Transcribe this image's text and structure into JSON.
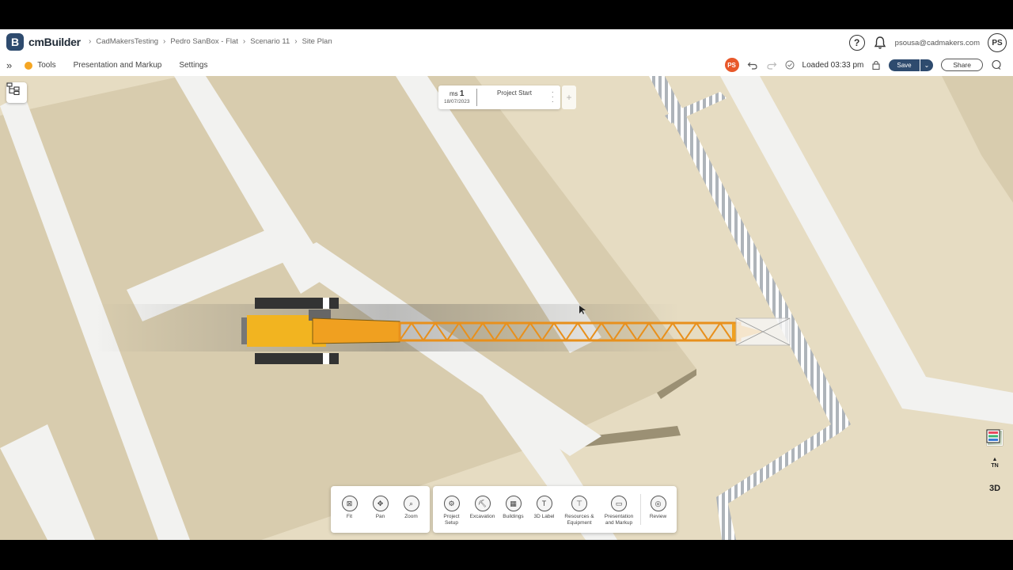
{
  "app": {
    "logo": "cmBuilder",
    "breadcrumb": [
      "CadMakersTesting",
      "Pedro SanBox - Flat",
      "Scenario 11",
      "Site Plan"
    ],
    "user_email": "psousa@cadmakers.com",
    "user_initials": "PS"
  },
  "toolbar": {
    "tools_label": "Tools",
    "presentation_label": "Presentation and Markup",
    "settings_label": "Settings",
    "loaded_status": "Loaded 03:33 pm",
    "save_label": "Save",
    "share_label": "Share"
  },
  "timeline": {
    "ms_prefix": "ms",
    "ms_number": "1",
    "date": "18/07/2023",
    "label": "Project Start",
    "add_label": "+"
  },
  "right_tools": {
    "north_label": "TN",
    "view3d_label": "3D"
  },
  "dock_view": [
    {
      "label": "Fit",
      "icon": "fit-icon"
    },
    {
      "label": "Pan",
      "icon": "pan-icon"
    },
    {
      "label": "Zoom",
      "icon": "zoom-icon"
    }
  ],
  "dock_main": [
    {
      "label": "Project\nSetup",
      "icon": "project-setup-icon"
    },
    {
      "label": "Excavation",
      "icon": "excavation-icon"
    },
    {
      "label": "Buildings",
      "icon": "buildings-icon"
    },
    {
      "label": "3D Label",
      "icon": "label-3d-icon"
    },
    {
      "label": "Resources &\nEquipment",
      "icon": "crane-icon"
    },
    {
      "label": "Presentation\nand Markup",
      "icon": "presentation-icon"
    },
    {
      "label": "Review",
      "icon": "review-icon"
    }
  ],
  "colors": {
    "brand": "#2e4b6e",
    "ground": "#e6dcc2",
    "road": "#f2f2f0",
    "building": "#d8ccae",
    "crane": "#f0a020",
    "warning": "#f5a623",
    "avatar": "#e8582a"
  }
}
